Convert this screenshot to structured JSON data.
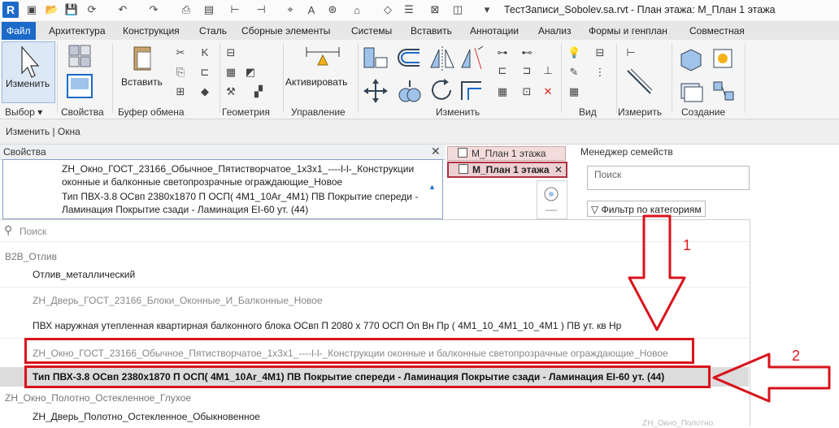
{
  "window": {
    "title": "ТестЗаписи_Sobolev.sa.rvt - План этажа: М_План 1 этажа",
    "logo_letter": "R"
  },
  "ribbon": {
    "tabs": [
      {
        "label": "Файл",
        "active": true
      },
      {
        "label": "Архитектура"
      },
      {
        "label": "Конструкция"
      },
      {
        "label": "Сталь"
      },
      {
        "label": "Сборные элементы"
      },
      {
        "label": "Системы"
      },
      {
        "label": "Вставить"
      },
      {
        "label": "Аннотации"
      },
      {
        "label": "Анализ"
      },
      {
        "label": "Формы и генплан"
      },
      {
        "label": "Совместная"
      }
    ],
    "modify_button": "Изменить",
    "paste_button": "Вставить",
    "activate_button": "Активировать",
    "groups": {
      "select": "Выбор",
      "properties": "Свойства",
      "clipboard": "Буфер обмена",
      "geometry": "Геометрия",
      "controls": "Управление",
      "modify": "Изменить",
      "view": "Вид",
      "measure": "Измерить",
      "create": "Создание"
    }
  },
  "context_bar": {
    "text": "Изменить | Окна"
  },
  "properties": {
    "title": "Свойства",
    "type_lines": [
      "ZH_Окно_ГОСТ_23166_Обычное_Пятистворчатое_1х3х1_----l-l-_Конструкции",
      "оконные и балконные светопрозрачные ограждающие_Новое",
      "Тип ПВХ-3.8 ОСвп 2380х1870 П ОСП( 4М1_10Ar_4М1) ПВ Покрытие спереди -",
      "Ламинация Покрытие сзади - Ламинация EI-60 ут. (44)"
    ]
  },
  "views": {
    "tab1": "М_План 1 этажа",
    "tab2": "М_План 1 этажа"
  },
  "family_manager": {
    "title": "Менеджер семейств",
    "search_placeholder": "Поиск",
    "filter": "Фильтр по категориям"
  },
  "dropdown": {
    "search_placeholder": "Поиск",
    "rows": [
      {
        "kind": "cat",
        "text": "B2B_Отлив"
      },
      {
        "kind": "typ",
        "text": "Отлив_металлический"
      },
      {
        "kind": "fam",
        "text": "ZH_Дверь_ГОСТ_23166_Блоки_Оконные_И_Балконные_Новое"
      },
      {
        "kind": "typ",
        "text": "ПВХ наружная утепленная квартирная балконного блока ОСвп П 2080 х 770 ОСП Оп Вн Пр ( 4М1_10_4М1_10_4М1 ) ПВ ут. кв Нр"
      },
      {
        "kind": "fam",
        "text": "ZH_Окно_ГОСТ_23166_Обычное_Пятистворчатое_1х3х1_----l-l-_Конструкции оконные и балконные светопрозрачные ограждающие_Новое"
      },
      {
        "kind": "typ",
        "text": "Тип ПВХ-3.8 ОСвп 2380х1870 П ОСП( 4М1_10Ar_4М1) ПВ Покрытие спереди - Ламинация Покрытие сзади - Ламинация EI-60 ут. (44)"
      },
      {
        "kind": "cat",
        "text": "ZH_Окно_Полотно_Остекленное_Глухое"
      },
      {
        "kind": "typ",
        "text": "ZH_Дверь_Полотно_Остекленное_Обыкновенное"
      }
    ]
  },
  "annotations": {
    "label1": "1",
    "label2": "2",
    "color": "#d8131b"
  },
  "ghost_text": "ZH_Окно_Полотно"
}
